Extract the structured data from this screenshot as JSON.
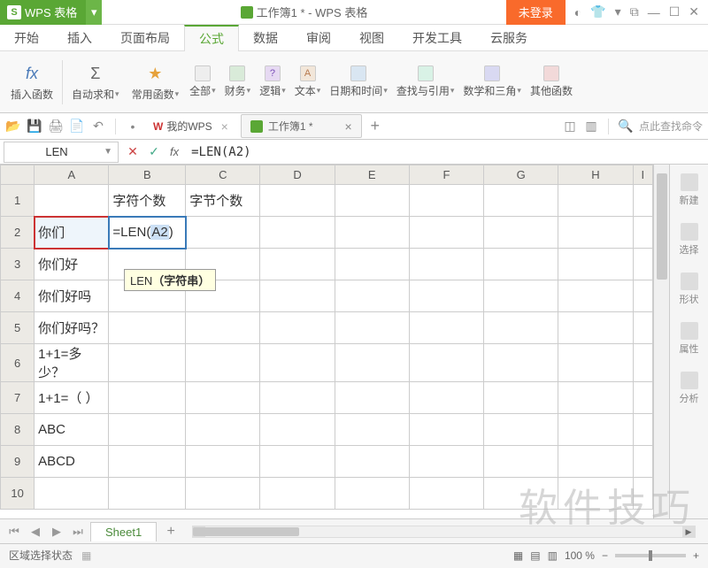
{
  "app": {
    "name": "WPS 表格",
    "doc_title": "工作簿1 * - WPS 表格",
    "login": "未登录"
  },
  "menu": {
    "items": [
      "开始",
      "插入",
      "页面布局",
      "公式",
      "数据",
      "审阅",
      "视图",
      "开发工具",
      "云服务"
    ],
    "active": 3
  },
  "ribbon": {
    "insert_fn": "插入函数",
    "autosum": "自动求和",
    "common": "常用函数",
    "all": "全部",
    "finance": "财务",
    "logic": "逻辑",
    "text": "文本",
    "datetime": "日期和时间",
    "lookup": "查找与引用",
    "math": "数学和三角",
    "other": "其他函数"
  },
  "quickbar": {
    "my_wps": "我的WPS",
    "doc_tab": "工作簿1 *",
    "search_placeholder": "点此查找命令"
  },
  "formula_bar": {
    "name_box": "LEN",
    "formula": "=LEN(A2)"
  },
  "columns": [
    "A",
    "B",
    "C",
    "D",
    "E",
    "F",
    "G",
    "H",
    "I"
  ],
  "rows": [
    {
      "n": 1,
      "A": "",
      "B": "字符个数",
      "C": "字节个数"
    },
    {
      "n": 2,
      "A": "你们",
      "B_formula": "=LEN(",
      "B_ref": "A2",
      "B_tail": ")"
    },
    {
      "n": 3,
      "A": "你们好"
    },
    {
      "n": 4,
      "A": "你们好吗"
    },
    {
      "n": 5,
      "A": "你们好吗？"
    },
    {
      "n": 6,
      "A": "1+1=多少？"
    },
    {
      "n": 7,
      "A": "1+1=（ ）"
    },
    {
      "n": 8,
      "A": "ABC"
    },
    {
      "n": 9,
      "A": "ABCD"
    },
    {
      "n": 10,
      "A": ""
    }
  ],
  "tooltip": {
    "fn": "LEN",
    "arg": "（字符串）"
  },
  "side_panel": {
    "items": [
      "新建",
      "选择",
      "形状",
      "属性",
      "分析"
    ]
  },
  "sheet_tabs": {
    "sheet1": "Sheet1"
  },
  "status": {
    "mode": "区域选择状态",
    "zoom": "100 %"
  },
  "watermark": "软件技巧"
}
